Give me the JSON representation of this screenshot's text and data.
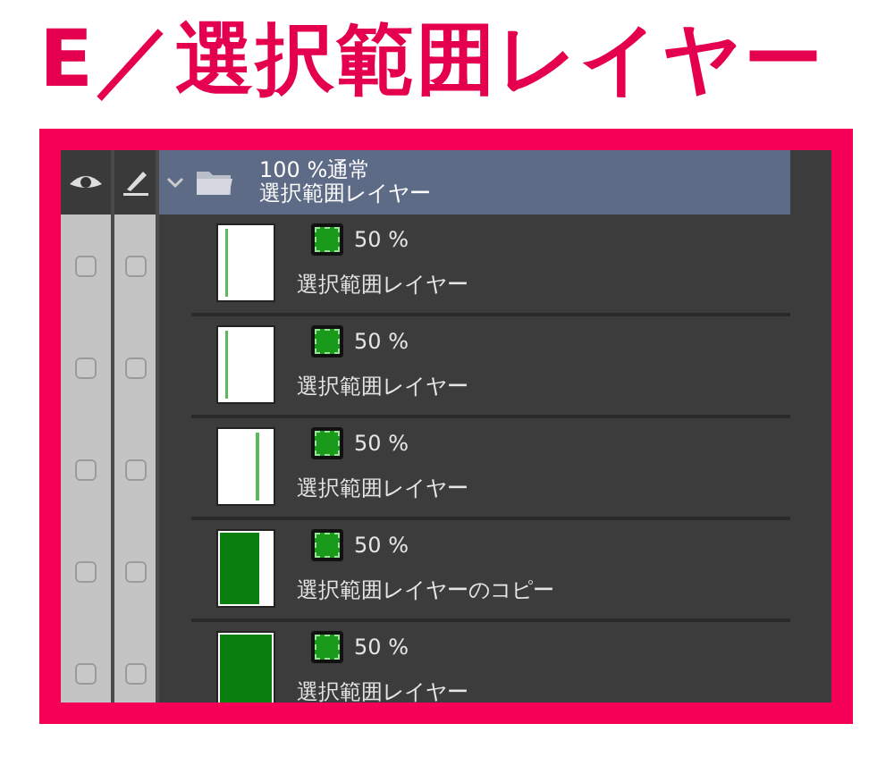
{
  "title": "E／選択範囲レイヤー",
  "group": {
    "opacity_mode": "100 %通常",
    "name": "選択範囲レイヤー",
    "visible": true,
    "editable": true,
    "expanded": true,
    "selected": true
  },
  "layers": [
    {
      "opacity": "50 %",
      "name": "選択範囲レイヤー",
      "kind": "thin-left",
      "visible": false,
      "editable": false,
      "selected": false
    },
    {
      "opacity": "50 %",
      "name": "選択範囲レイヤー",
      "kind": "thin-left",
      "visible": false,
      "editable": false,
      "selected": false
    },
    {
      "opacity": "50 %",
      "name": "選択範囲レイヤー",
      "kind": "thin-mid",
      "visible": false,
      "editable": false,
      "selected": false
    },
    {
      "opacity": "50 %",
      "name": "選択範囲レイヤーのコピー",
      "kind": "wide",
      "visible": false,
      "editable": false,
      "selected": false
    },
    {
      "opacity": "50 %",
      "name": "選択範囲レイヤー",
      "kind": "full",
      "visible": false,
      "editable": false,
      "selected": false
    }
  ]
}
